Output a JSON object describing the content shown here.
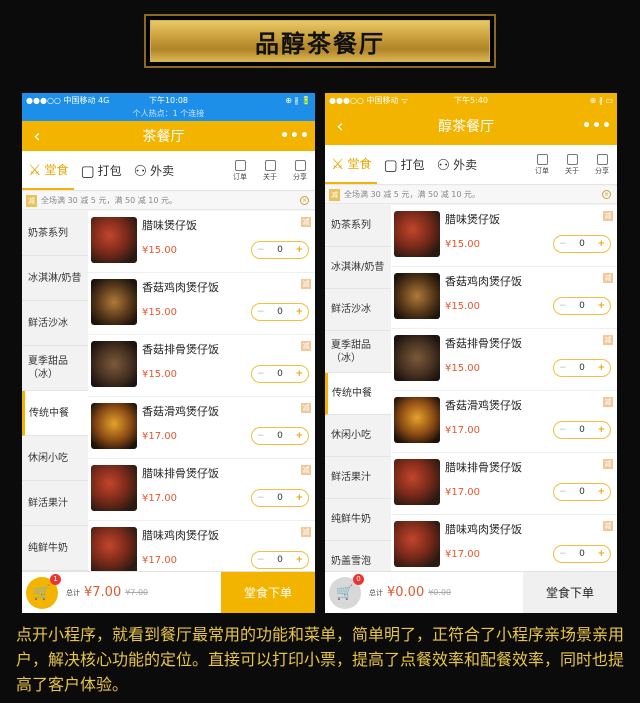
{
  "banner": {
    "title": "品醇茶餐厅"
  },
  "phone1": {
    "status": {
      "carrier": "●●●○○ 中国移动  4G",
      "time": "下午10:08",
      "indicators": "⊕ ∦ 🔋"
    },
    "hotspot": "个人热点：1 个连接",
    "nav": {
      "back": "‹",
      "title": "茶餐厅",
      "more": "•••"
    },
    "tabs": [
      {
        "icon": "⚔",
        "label": "堂食"
      },
      {
        "icon": "▢",
        "label": "打包"
      },
      {
        "icon": "⚇",
        "label": "外卖"
      }
    ],
    "mini": [
      "订单",
      "关于",
      "分享"
    ],
    "promo": {
      "badge": "减",
      "text": "全场满 30 减 5 元，满 50 减 10 元。"
    },
    "categories": [
      "奶茶系列",
      "冰淇淋/奶昔",
      "鲜活沙冰",
      "夏季甜品（冰）",
      "传统中餐",
      "休闲小吃",
      "鲜活果汁",
      "纯鲜牛奶"
    ],
    "items": [
      {
        "name": "腊味煲仔饭",
        "price": "¥15.00",
        "qty": "0",
        "badge": "减"
      },
      {
        "name": "香菇鸡肉煲仔饭",
        "price": "¥15.00",
        "qty": "0",
        "badge": "减"
      },
      {
        "name": "香菇排骨煲仔饭",
        "price": "¥15.00",
        "qty": "0",
        "badge": "减"
      },
      {
        "name": "香菇滑鸡煲仔饭",
        "price": "¥17.00",
        "qty": "0",
        "badge": "减"
      },
      {
        "name": "腊味排骨煲仔饭",
        "price": "¥17.00",
        "qty": "0",
        "badge": "减"
      },
      {
        "name": "腊味鸡肉煲仔饭",
        "price": "¥17.00",
        "qty": "0",
        "badge": "减"
      }
    ],
    "cart": {
      "count": "1",
      "total_label": "总计",
      "total": "¥7.00",
      "original": "¥7.00",
      "order": "堂食下单"
    }
  },
  "phone2": {
    "status": {
      "carrier": "●●●○○ 中国移动 ᯤ",
      "time": "下午5:40",
      "indicators": "⊕ ∦ ▭"
    },
    "nav": {
      "back": "‹",
      "title": "醇茶餐厅",
      "more": "•••"
    },
    "tabs": [
      {
        "icon": "⚔",
        "label": "堂食"
      },
      {
        "icon": "▢",
        "label": "打包"
      },
      {
        "icon": "⚇",
        "label": "外卖"
      }
    ],
    "mini": [
      "订单",
      "关于",
      "分享"
    ],
    "promo": {
      "badge": "减",
      "text": "全场满 30 减 5 元，满 50 减 10 元。"
    },
    "categories": [
      "奶茶系列",
      "冰淇淋/奶昔",
      "鲜活沙冰",
      "夏季甜品（冰）",
      "传统中餐",
      "休闲小吃",
      "鲜活果汁",
      "纯鲜牛奶",
      "奶盖雪泡"
    ],
    "items": [
      {
        "name": "腊味煲仔饭",
        "price": "¥15.00",
        "qty": "0",
        "badge": "减"
      },
      {
        "name": "香菇鸡肉煲仔饭",
        "price": "¥15.00",
        "qty": "0",
        "badge": "减"
      },
      {
        "name": "香菇排骨煲仔饭",
        "price": "¥15.00",
        "qty": "0",
        "badge": "减"
      },
      {
        "name": "香菇滑鸡煲仔饭",
        "price": "¥17.00",
        "qty": "0",
        "badge": "减"
      },
      {
        "name": "腊味排骨煲仔饭",
        "price": "¥17.00",
        "qty": "0",
        "badge": "减"
      },
      {
        "name": "腊味鸡肉煲仔饭",
        "price": "¥17.00",
        "qty": "0",
        "badge": "减"
      }
    ],
    "cart": {
      "count": "0",
      "total_label": "总计",
      "total": "¥0.00",
      "original": "¥0.00",
      "order": "堂食下单"
    }
  },
  "caption": "点开小程序，就看到餐厅最常用的功能和菜单，简单明了，正符合了小程序亲场景亲用户，解决核心功能的定位。直接可以打印小票，提高了点餐效率和配餐效率，同时也提高了客户体验。",
  "colors": {
    "accent": "#f3b400",
    "ios_blue": "#1d8fe8",
    "price": "#e4572e",
    "caption": "#e8c547"
  }
}
